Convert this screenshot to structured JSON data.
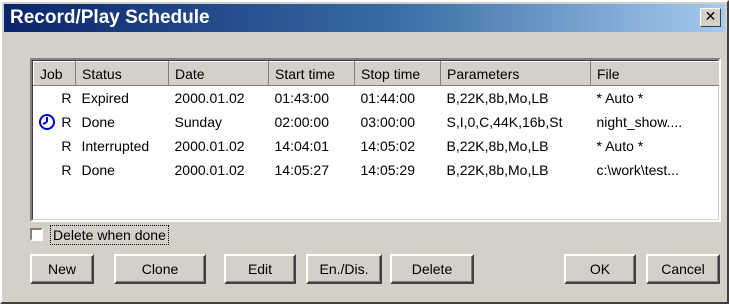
{
  "window": {
    "title": "Record/Play Schedule",
    "close_glyph": "✕"
  },
  "table": {
    "headers": [
      "Job",
      "Status",
      "Date",
      "Start time",
      "Stop time",
      "Parameters",
      "File"
    ],
    "rows": [
      {
        "icon": "",
        "job": "R",
        "status": "Expired",
        "date": "2000.01.02",
        "start": "01:43:00",
        "stop": "01:44:00",
        "params": "B,22K,8b,Mo,LB",
        "file": "* Auto *"
      },
      {
        "icon": "clock-icon",
        "job": "R",
        "status": "Done",
        "date": "Sunday",
        "start": "02:00:00",
        "stop": "03:00:00",
        "params": "S,I,0,C,44K,16b,St",
        "file": "night_show...."
      },
      {
        "icon": "",
        "job": "R",
        "status": "Interrupted",
        "date": "2000.01.02",
        "start": "14:04:01",
        "stop": "14:05:02",
        "params": "B,22K,8b,Mo,LB",
        "file": "* Auto *"
      },
      {
        "icon": "",
        "job": "R",
        "status": "Done",
        "date": "2000.01.02",
        "start": "14:05:27",
        "stop": "14:05:29",
        "params": "B,22K,8b,Mo,LB",
        "file": "c:\\work\\test..."
      }
    ]
  },
  "options": {
    "delete_when_done": {
      "label": "Delete when done",
      "checked": false
    }
  },
  "buttons": {
    "new": "New",
    "clone": "Clone",
    "edit": "Edit",
    "en_dis": "En./Dis.",
    "delete": "Delete",
    "ok": "OK",
    "cancel": "Cancel"
  },
  "colors": {
    "title_bar_start": "#0a246a",
    "title_bar_end": "#a6caf0",
    "face": "#d4d0c8",
    "clock_icon": "#0000c0"
  }
}
